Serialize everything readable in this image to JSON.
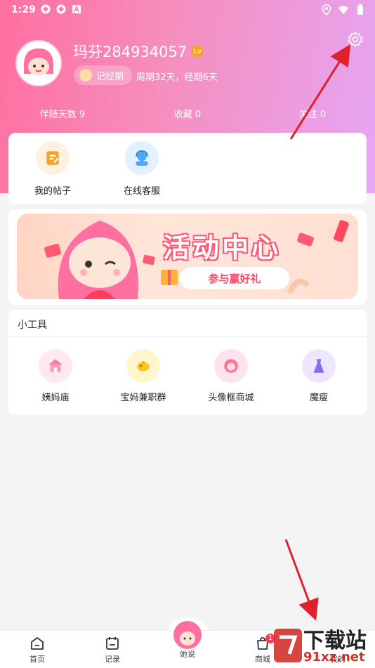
{
  "status_bar": {
    "time": "1:29"
  },
  "profile": {
    "username": "玛芬284934057",
    "vip_badge": "Lv",
    "record_button": "记经期",
    "cycle_info": "周期32天，经期6天"
  },
  "stats": [
    {
      "label": "伴随天数 9"
    },
    {
      "label": "收藏 0"
    },
    {
      "label": "关注 0"
    }
  ],
  "menu": [
    {
      "label": "我的帖子",
      "icon": "note-icon",
      "color": "#f5a32a"
    },
    {
      "label": "在线客服",
      "icon": "customer-service-icon",
      "color": "#4aa8ff"
    }
  ],
  "banner": {
    "title": "活动中心",
    "pill": "参与赢好礼"
  },
  "tools": {
    "title": "小工具",
    "items": [
      {
        "label": "姨妈庙",
        "icon": "temple-icon",
        "color": "#ff7aa6"
      },
      {
        "label": "宝妈兼职群",
        "icon": "piggy-bank-icon",
        "color": "#f5c623"
      },
      {
        "label": "头像框商城",
        "icon": "avatar-frame-icon",
        "color": "#ff6f9f"
      },
      {
        "label": "魔瘦",
        "icon": "dress-icon",
        "color": "#8b6cf0"
      }
    ]
  },
  "tabs": [
    {
      "label": "首页",
      "icon": "home-icon"
    },
    {
      "label": "记录",
      "icon": "calendar-icon"
    },
    {
      "label": "她说",
      "icon": "mascot-icon"
    },
    {
      "label": "商城",
      "icon": "shop-bag-icon",
      "badge": "1"
    },
    {
      "label": "我的",
      "icon": "profile-icon"
    }
  ],
  "watermark": {
    "line1": "下载站",
    "line2": "91xz.net"
  },
  "colors": {
    "header_start": "#ff6f9f",
    "header_end": "#e6a6f4",
    "accent": "#ff4a6a",
    "annotation_arrow": "#e0202a"
  }
}
